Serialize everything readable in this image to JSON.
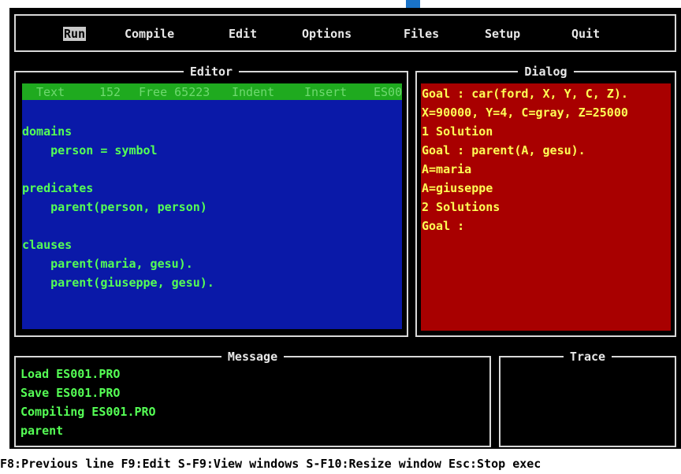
{
  "menu": {
    "items": [
      "Run",
      "Compile",
      "Edit",
      "Options",
      "Files",
      "Setup",
      "Quit"
    ],
    "active": "Run"
  },
  "editor": {
    "title": "Editor",
    "status": {
      "text_label": "Text",
      "position": "152",
      "free": "Free 65223",
      "indent": "Indent",
      "insert": "Insert",
      "file": "ES00"
    },
    "lines": [
      "domains",
      "    person = symbol",
      "",
      "predicates",
      "    parent(person, person)",
      "",
      "clauses",
      "    parent(maria, gesu).",
      "    parent(giuseppe, gesu)."
    ]
  },
  "dialog": {
    "title": "Dialog",
    "lines": [
      "Goal : car(ford, X, Y, C, Z).",
      "X=90000, Y=4, C=gray, Z=25000",
      "1 Solution",
      "Goal : parent(A, gesu).",
      "A=maria",
      "A=giuseppe",
      "2 Solutions",
      "Goal :"
    ]
  },
  "message": {
    "title": "Message",
    "lines": [
      "Load ES001.PRO",
      "Save ES001.PRO",
      "Compiling ES001.PRO",
      "parent"
    ]
  },
  "trace": {
    "title": "Trace"
  },
  "status_bar": "F8:Previous line  F9:Edit  S-F9:View windows  S-F10:Resize window  Esc:Stop exec",
  "colors": {
    "screen_bg": "#000000",
    "editor_bg": "#0a19a8",
    "editor_text": "#55ff55",
    "editor_status_bg": "#1faa1f",
    "dialog_bg": "#a80000",
    "dialog_text": "#ffff55",
    "frame": "#d8d8d8"
  }
}
